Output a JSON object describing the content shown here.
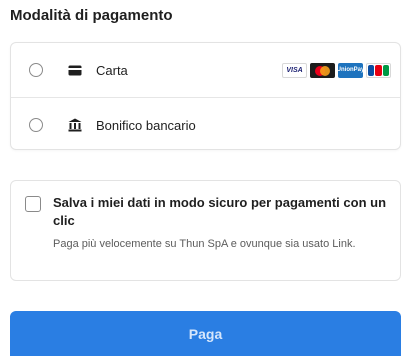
{
  "header": {
    "title": "Modalità di pagamento"
  },
  "payment_methods": [
    {
      "label": "Carta",
      "icon": "card-icon",
      "selected": false
    },
    {
      "label": "Bonifico bancario",
      "icon": "bank-icon",
      "selected": false
    }
  ],
  "card_brands": {
    "visa": "VISA",
    "unionpay": "UnionPay"
  },
  "save": {
    "title": "Salva i miei dati in modo sicuro per pagamenti con un clic",
    "subtitle": "Paga più velocemente su Thun SpA e ovunque sia usato Link.",
    "checked": false
  },
  "pay_button": {
    "label": "Paga"
  },
  "colors": {
    "accent": "#2a7ee3",
    "pay_text": "#d6e6fb"
  }
}
